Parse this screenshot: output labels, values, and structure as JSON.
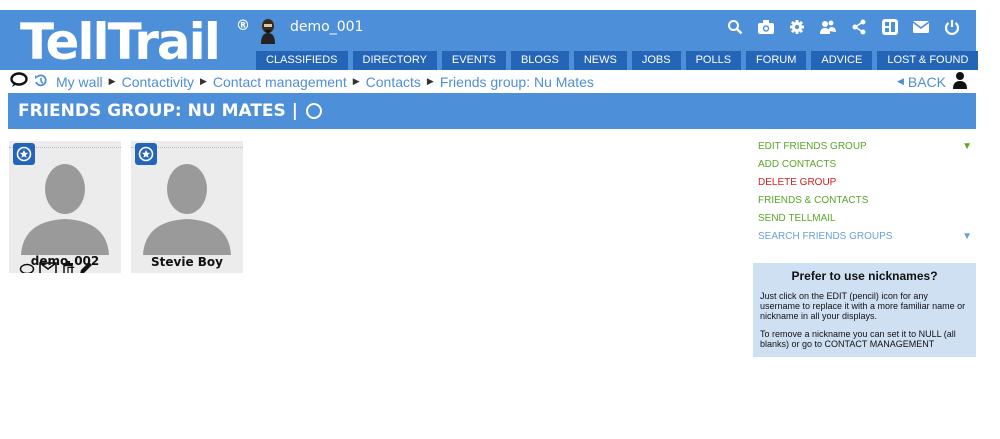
{
  "header": {
    "logo": "TellTrail",
    "registered_mark": "®",
    "username": "demo_001",
    "icons": [
      "search-icon",
      "camera-icon",
      "gear-icon",
      "users-icon",
      "share-icon",
      "profile-card-icon",
      "mail-icon",
      "power-icon"
    ]
  },
  "nav": {
    "tabs": [
      {
        "label": "CLASSIFIEDS"
      },
      {
        "label": "DIRECTORY"
      },
      {
        "label": "EVENTS"
      },
      {
        "label": "BLOGS"
      },
      {
        "label": "NEWS"
      },
      {
        "label": "JOBS"
      },
      {
        "label": "POLLS"
      },
      {
        "label": "FORUM"
      },
      {
        "label": "ADVICE"
      },
      {
        "label": "LOST & FOUND"
      }
    ]
  },
  "breadcrumb": {
    "items": [
      "My wall",
      "Contactivity",
      "Contact management",
      "Contacts",
      "Friends group: Nu Mates"
    ],
    "back_label": "BACK"
  },
  "title": {
    "text": "FRIENDS GROUP: NU MATES |"
  },
  "cards": [
    {
      "name": "demo_002",
      "show_actions": true
    },
    {
      "name": "Stevie Boy",
      "show_actions": false
    }
  ],
  "right_menu": {
    "items": [
      {
        "label": "EDIT FRIENDS GROUP",
        "color": "green",
        "arrow": "▼"
      },
      {
        "label": "ADD CONTACTS",
        "color": "green",
        "arrow": ""
      },
      {
        "label": "DELETE GROUP",
        "color": "red",
        "arrow": ""
      },
      {
        "label": "FRIENDS & CONTACTS",
        "color": "green",
        "arrow": ""
      },
      {
        "label": "SEND TELLMAIL",
        "color": "green",
        "arrow": ""
      },
      {
        "label": "SEARCH FRIENDS GROUPS",
        "color": "blue",
        "arrow": "▼"
      }
    ]
  },
  "info_box": {
    "title": "Prefer to use nicknames?",
    "para1": "Just click on the EDIT (pencil) icon for any username to replace it with a more familiar name or nickname in all your displays.",
    "para2": "To remove a nickname you can set it to NULL (all blanks) or go to CONTACT MANAGEMENT"
  },
  "colors": {
    "brand_blue": "#4d8fd8",
    "tab_blue": "#2565b8",
    "menu_green": "#5aa62a",
    "menu_red": "#d42020",
    "info_bg": "#cfe0f3"
  }
}
